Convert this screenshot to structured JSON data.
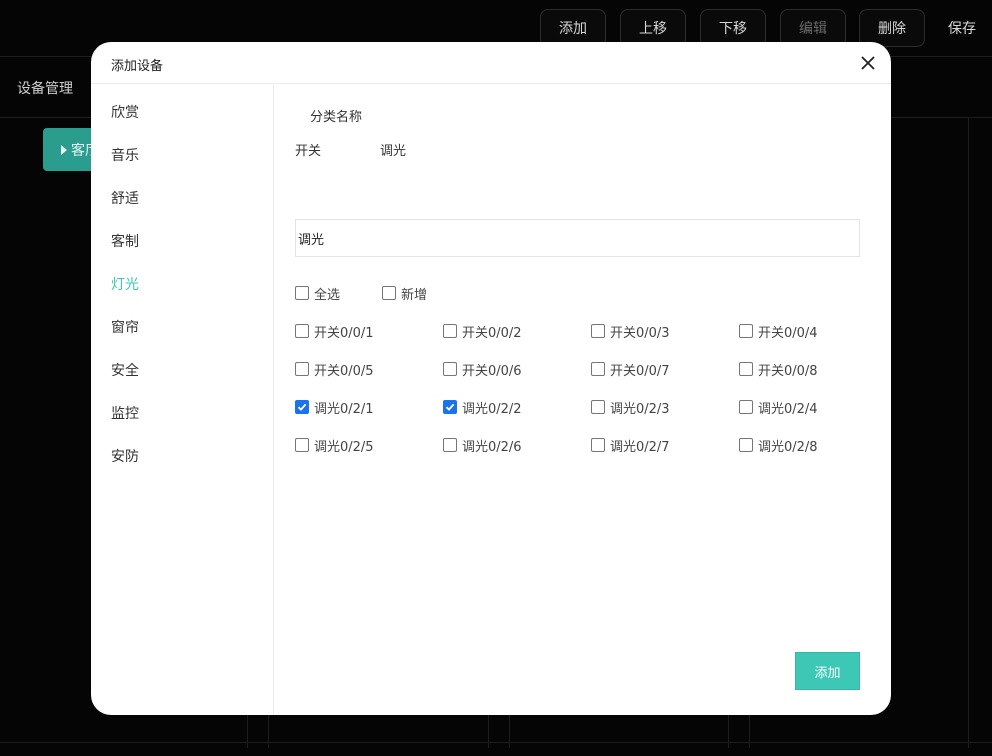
{
  "toolbar": {
    "add": "添加",
    "move_up": "上移",
    "move_down": "下移",
    "edit": "编辑",
    "delete": "删除",
    "save": "保存"
  },
  "background": {
    "section_title": "设备管理",
    "room_button": "客厅"
  },
  "modal": {
    "title": "添加设备",
    "category_label": "分类名称",
    "type_tabs": [
      "开关",
      "调光"
    ],
    "name_input_value": "调光",
    "select_all": "全选",
    "new_item": "新增",
    "add_button": "添加",
    "categories": [
      {
        "label": "欣赏",
        "active": false
      },
      {
        "label": "音乐",
        "active": false
      },
      {
        "label": "舒适",
        "active": false
      },
      {
        "label": "客制",
        "active": false
      },
      {
        "label": "灯光",
        "active": true
      },
      {
        "label": "窗帘",
        "active": false
      },
      {
        "label": "安全",
        "active": false
      },
      {
        "label": "监控",
        "active": false
      },
      {
        "label": "安防",
        "active": false
      }
    ],
    "devices": [
      {
        "label": "开关0/0/1",
        "checked": false
      },
      {
        "label": "开关0/0/2",
        "checked": false
      },
      {
        "label": "开关0/0/3",
        "checked": false
      },
      {
        "label": "开关0/0/4",
        "checked": false
      },
      {
        "label": "开关0/0/5",
        "checked": false
      },
      {
        "label": "开关0/0/6",
        "checked": false
      },
      {
        "label": "开关0/0/7",
        "checked": false
      },
      {
        "label": "开关0/0/8",
        "checked": false
      },
      {
        "label": "调光0/2/1",
        "checked": true
      },
      {
        "label": "调光0/2/2",
        "checked": true
      },
      {
        "label": "调光0/2/3",
        "checked": false
      },
      {
        "label": "调光0/2/4",
        "checked": false
      },
      {
        "label": "调光0/2/5",
        "checked": false
      },
      {
        "label": "调光0/2/6",
        "checked": false
      },
      {
        "label": "调光0/2/7",
        "checked": false
      },
      {
        "label": "调光0/2/8",
        "checked": false
      }
    ]
  },
  "colors": {
    "accent": "#3cc8b4",
    "checkbox_checked": "#1a73e8"
  }
}
